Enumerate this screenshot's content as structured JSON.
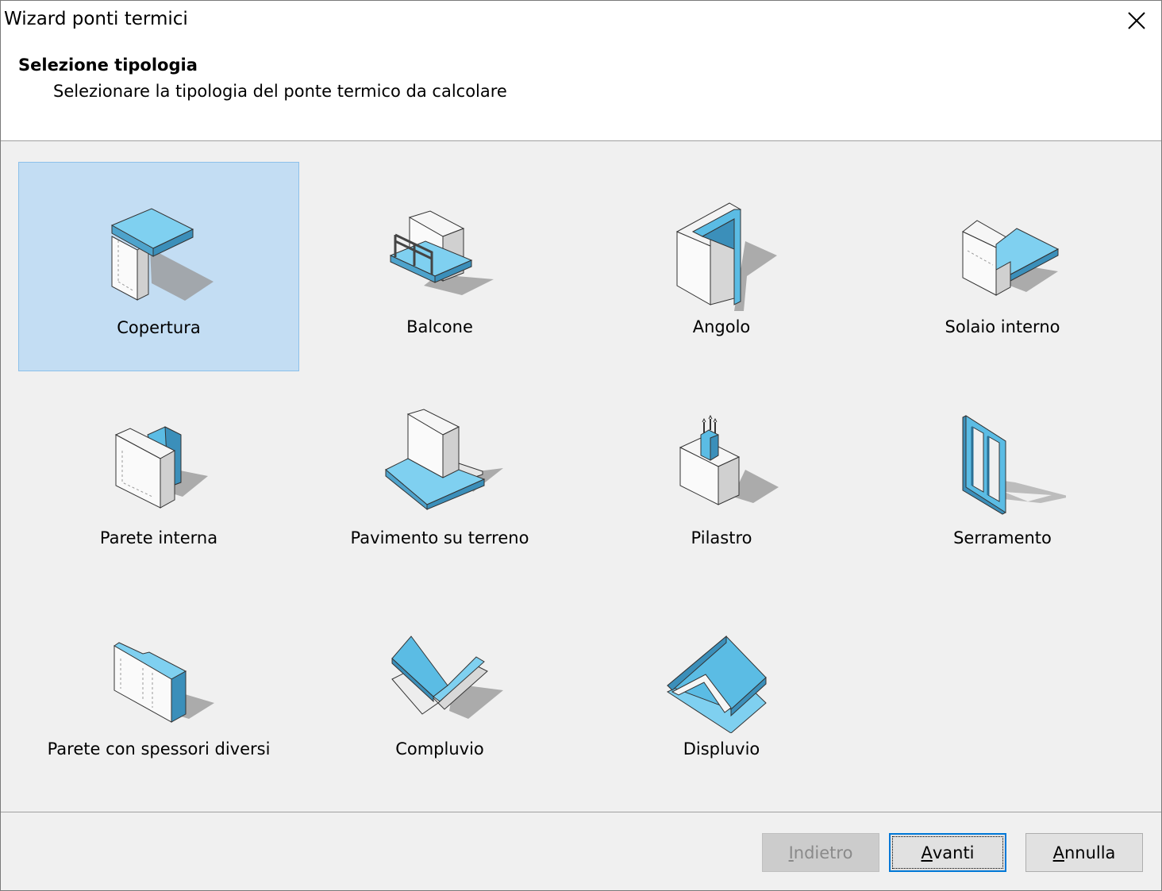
{
  "window": {
    "title": "Wizard ponti termici"
  },
  "header": {
    "title": "Selezione tipologia",
    "subtitle": "Selezionare la tipologia del ponte termico da calcolare"
  },
  "colors": {
    "accent": "#5bbce4",
    "selection": "#c3ddf3",
    "selection_border": "#8dc0ea",
    "default_button_border": "#0078d7"
  },
  "types": [
    {
      "label": "Copertura",
      "icon": "roof-junction-icon",
      "selected": true
    },
    {
      "label": "Balcone",
      "icon": "balcony-icon",
      "selected": false
    },
    {
      "label": "Angolo",
      "icon": "corner-icon",
      "selected": false
    },
    {
      "label": "Solaio interno",
      "icon": "internal-floor-icon",
      "selected": false
    },
    {
      "label": "Parete interna",
      "icon": "internal-wall-icon",
      "selected": false
    },
    {
      "label": "Pavimento su terreno",
      "icon": "ground-floor-icon",
      "selected": false
    },
    {
      "label": "Pilastro",
      "icon": "pillar-icon",
      "selected": false
    },
    {
      "label": "Serramento",
      "icon": "window-frame-icon",
      "selected": false
    },
    {
      "label": "Parete con spessori diversi",
      "icon": "wall-thickness-change-icon",
      "selected": false
    },
    {
      "label": "Compluvio",
      "icon": "valley-icon",
      "selected": false
    },
    {
      "label": "Displuvio",
      "icon": "ridge-icon",
      "selected": false
    }
  ],
  "buttons": {
    "back": {
      "mnemonic": "I",
      "rest": "ndietro",
      "enabled": false
    },
    "next": {
      "mnemonic": "A",
      "rest": "vanti",
      "enabled": true
    },
    "cancel": {
      "mnemonic": "A",
      "rest": "nnulla",
      "enabled": true
    }
  }
}
